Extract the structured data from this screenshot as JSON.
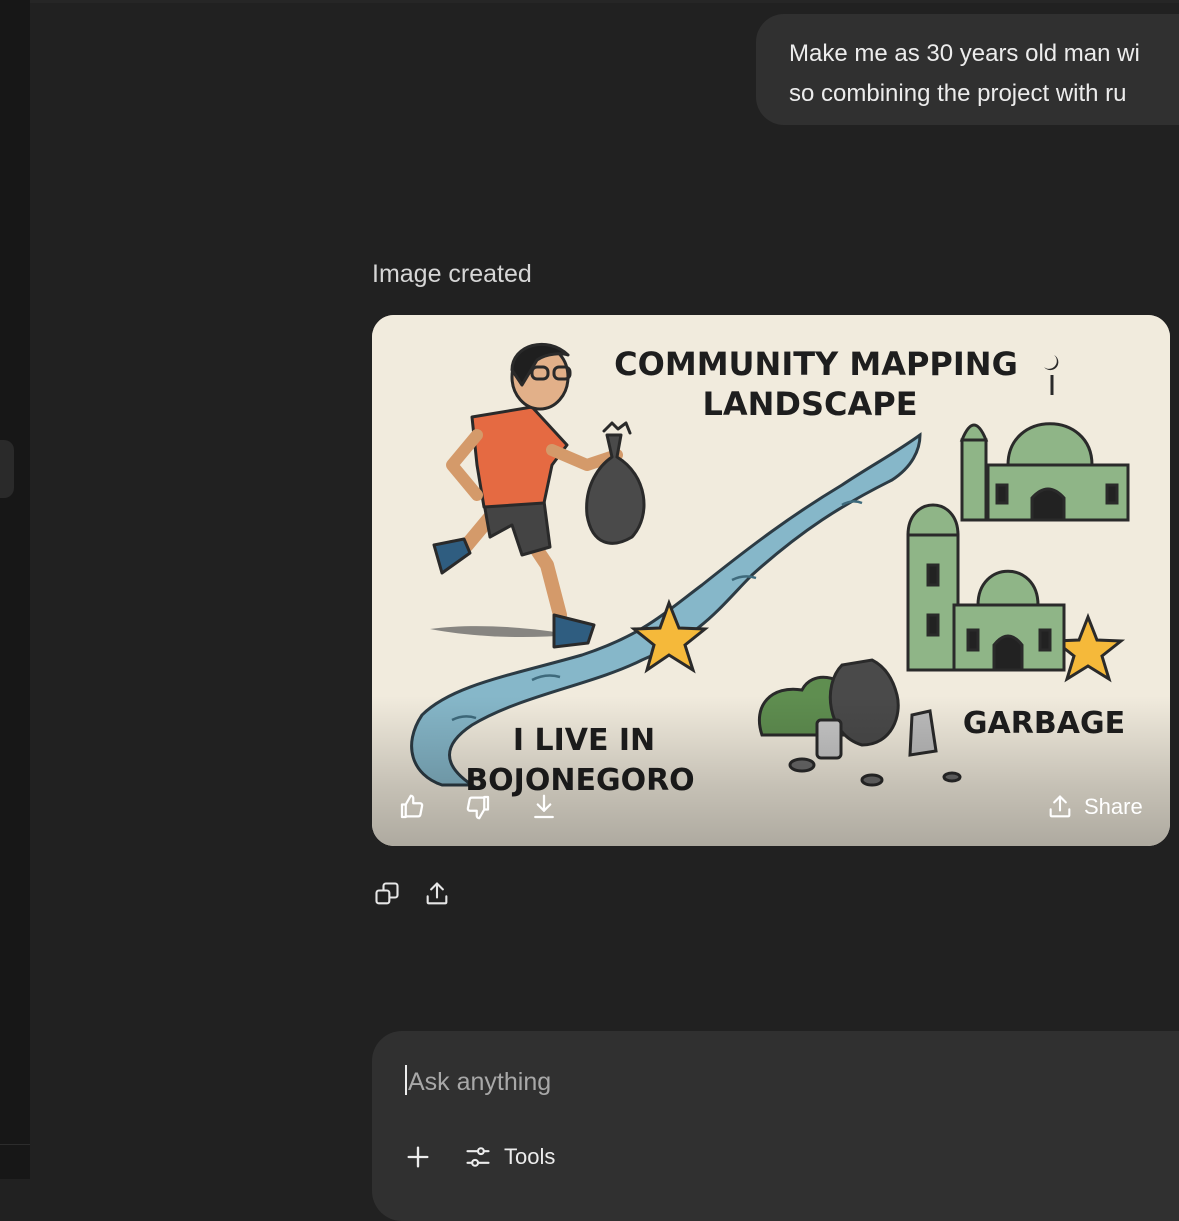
{
  "conversation": {
    "user_message": {
      "line1": "Make me as 30 years old man wi",
      "line2": "so combining the project with ru"
    },
    "assistant": {
      "status": "Image created",
      "image": {
        "title_line1": "COMMUNITY MAPPING",
        "title_line2": "LANDSCAPE",
        "caption_line1": "I LIVE IN",
        "caption_line2": "BOJONEGORO",
        "label_garbage": "GARBAGE"
      },
      "image_actions": {
        "share_label": "Share"
      }
    }
  },
  "composer": {
    "placeholder": "Ask anything",
    "tools_label": "Tools"
  },
  "icons": [
    "thumbs-up-icon",
    "thumbs-down-icon",
    "download-icon",
    "share-icon",
    "copy-icon",
    "plus-icon",
    "sliders-icon"
  ]
}
